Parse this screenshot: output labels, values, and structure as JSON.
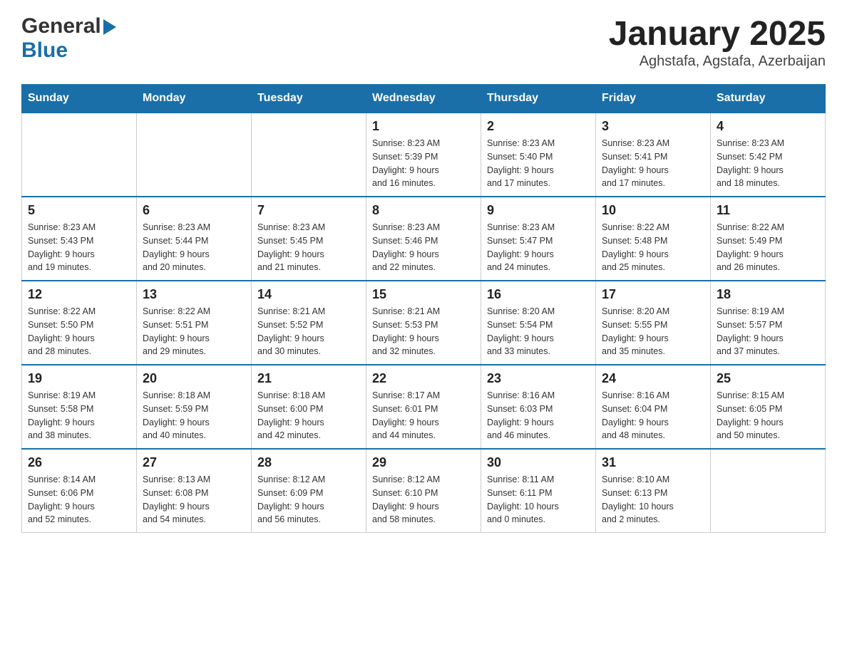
{
  "header": {
    "title": "January 2025",
    "subtitle": "Aghstafa, Agstafa, Azerbaijan",
    "logo_general": "General",
    "logo_blue": "Blue"
  },
  "calendar": {
    "days_of_week": [
      "Sunday",
      "Monday",
      "Tuesday",
      "Wednesday",
      "Thursday",
      "Friday",
      "Saturday"
    ],
    "weeks": [
      [
        {
          "day": "",
          "info": ""
        },
        {
          "day": "",
          "info": ""
        },
        {
          "day": "",
          "info": ""
        },
        {
          "day": "1",
          "info": "Sunrise: 8:23 AM\nSunset: 5:39 PM\nDaylight: 9 hours\nand 16 minutes."
        },
        {
          "day": "2",
          "info": "Sunrise: 8:23 AM\nSunset: 5:40 PM\nDaylight: 9 hours\nand 17 minutes."
        },
        {
          "day": "3",
          "info": "Sunrise: 8:23 AM\nSunset: 5:41 PM\nDaylight: 9 hours\nand 17 minutes."
        },
        {
          "day": "4",
          "info": "Sunrise: 8:23 AM\nSunset: 5:42 PM\nDaylight: 9 hours\nand 18 minutes."
        }
      ],
      [
        {
          "day": "5",
          "info": "Sunrise: 8:23 AM\nSunset: 5:43 PM\nDaylight: 9 hours\nand 19 minutes."
        },
        {
          "day": "6",
          "info": "Sunrise: 8:23 AM\nSunset: 5:44 PM\nDaylight: 9 hours\nand 20 minutes."
        },
        {
          "day": "7",
          "info": "Sunrise: 8:23 AM\nSunset: 5:45 PM\nDaylight: 9 hours\nand 21 minutes."
        },
        {
          "day": "8",
          "info": "Sunrise: 8:23 AM\nSunset: 5:46 PM\nDaylight: 9 hours\nand 22 minutes."
        },
        {
          "day": "9",
          "info": "Sunrise: 8:23 AM\nSunset: 5:47 PM\nDaylight: 9 hours\nand 24 minutes."
        },
        {
          "day": "10",
          "info": "Sunrise: 8:22 AM\nSunset: 5:48 PM\nDaylight: 9 hours\nand 25 minutes."
        },
        {
          "day": "11",
          "info": "Sunrise: 8:22 AM\nSunset: 5:49 PM\nDaylight: 9 hours\nand 26 minutes."
        }
      ],
      [
        {
          "day": "12",
          "info": "Sunrise: 8:22 AM\nSunset: 5:50 PM\nDaylight: 9 hours\nand 28 minutes."
        },
        {
          "day": "13",
          "info": "Sunrise: 8:22 AM\nSunset: 5:51 PM\nDaylight: 9 hours\nand 29 minutes."
        },
        {
          "day": "14",
          "info": "Sunrise: 8:21 AM\nSunset: 5:52 PM\nDaylight: 9 hours\nand 30 minutes."
        },
        {
          "day": "15",
          "info": "Sunrise: 8:21 AM\nSunset: 5:53 PM\nDaylight: 9 hours\nand 32 minutes."
        },
        {
          "day": "16",
          "info": "Sunrise: 8:20 AM\nSunset: 5:54 PM\nDaylight: 9 hours\nand 33 minutes."
        },
        {
          "day": "17",
          "info": "Sunrise: 8:20 AM\nSunset: 5:55 PM\nDaylight: 9 hours\nand 35 minutes."
        },
        {
          "day": "18",
          "info": "Sunrise: 8:19 AM\nSunset: 5:57 PM\nDaylight: 9 hours\nand 37 minutes."
        }
      ],
      [
        {
          "day": "19",
          "info": "Sunrise: 8:19 AM\nSunset: 5:58 PM\nDaylight: 9 hours\nand 38 minutes."
        },
        {
          "day": "20",
          "info": "Sunrise: 8:18 AM\nSunset: 5:59 PM\nDaylight: 9 hours\nand 40 minutes."
        },
        {
          "day": "21",
          "info": "Sunrise: 8:18 AM\nSunset: 6:00 PM\nDaylight: 9 hours\nand 42 minutes."
        },
        {
          "day": "22",
          "info": "Sunrise: 8:17 AM\nSunset: 6:01 PM\nDaylight: 9 hours\nand 44 minutes."
        },
        {
          "day": "23",
          "info": "Sunrise: 8:16 AM\nSunset: 6:03 PM\nDaylight: 9 hours\nand 46 minutes."
        },
        {
          "day": "24",
          "info": "Sunrise: 8:16 AM\nSunset: 6:04 PM\nDaylight: 9 hours\nand 48 minutes."
        },
        {
          "day": "25",
          "info": "Sunrise: 8:15 AM\nSunset: 6:05 PM\nDaylight: 9 hours\nand 50 minutes."
        }
      ],
      [
        {
          "day": "26",
          "info": "Sunrise: 8:14 AM\nSunset: 6:06 PM\nDaylight: 9 hours\nand 52 minutes."
        },
        {
          "day": "27",
          "info": "Sunrise: 8:13 AM\nSunset: 6:08 PM\nDaylight: 9 hours\nand 54 minutes."
        },
        {
          "day": "28",
          "info": "Sunrise: 8:12 AM\nSunset: 6:09 PM\nDaylight: 9 hours\nand 56 minutes."
        },
        {
          "day": "29",
          "info": "Sunrise: 8:12 AM\nSunset: 6:10 PM\nDaylight: 9 hours\nand 58 minutes."
        },
        {
          "day": "30",
          "info": "Sunrise: 8:11 AM\nSunset: 6:11 PM\nDaylight: 10 hours\nand 0 minutes."
        },
        {
          "day": "31",
          "info": "Sunrise: 8:10 AM\nSunset: 6:13 PM\nDaylight: 10 hours\nand 2 minutes."
        },
        {
          "day": "",
          "info": ""
        }
      ]
    ]
  }
}
